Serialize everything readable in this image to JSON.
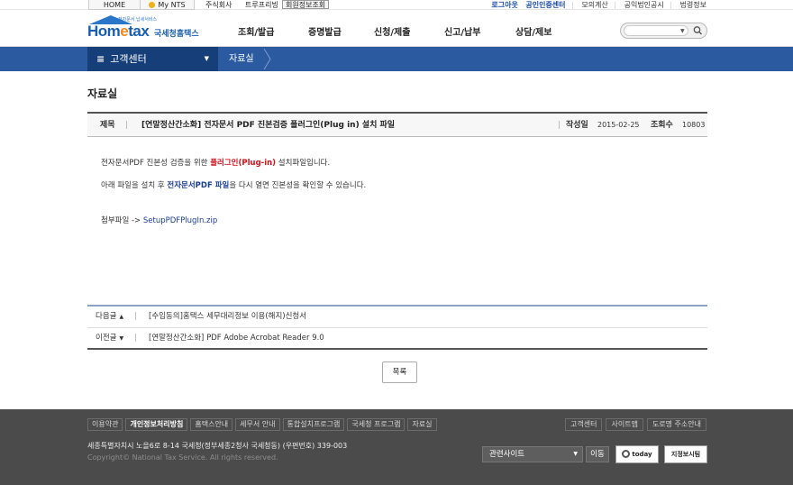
{
  "util": {
    "home": "HOME",
    "mynts": "My NTS",
    "link_a": "주식회사",
    "link_b": "트루프리빙",
    "link_c": "회원정보조회",
    "right": [
      "로그아웃",
      "공인인증센터",
      "모의계산",
      "공익법인공시",
      "법령정보"
    ]
  },
  "header": {
    "logo_small": "전자문서 납세서비스",
    "logo_word_a": "Hom",
    "logo_word_e": "e",
    "logo_word_b": "tax",
    "logo_kr": "국세청홈택스",
    "gnb": [
      "조회/발급",
      "증명발급",
      "신청/제출",
      "신고/납부",
      "상담/제보"
    ],
    "search_placeholder": ""
  },
  "bluebar": {
    "menu_label": "고객센터",
    "crumb": "자료실"
  },
  "content": {
    "page_title": "자료실",
    "subject_label": "제목",
    "subject": "[연말정산간소화] 전자문서 PDF 진본검증 플러그인(Plug in) 설치 파일",
    "written_label": "작성일",
    "written_date": "2015-02-25",
    "views_label": "조회수",
    "views": "10803",
    "line1_a": "전자문서PDF 진본성 검증을 위한 ",
    "line1_red": "플러그인(Plug-in)",
    "line1_b": " 설치파일입니다.",
    "line2_a": "아래 파일을 설치 후 ",
    "line2_navy": "전자문서PDF 파일",
    "line2_b": "을 다시 열면 진본성을 확인할 수 있습니다.",
    "attach_label": "첨부파일 ->",
    "attach_file": "SetupPDFPlugIn.zip",
    "next_label": "다음글",
    "next_title": "[수임동의]홈택스 세무대리정보 이용(해지)신청서",
    "prev_label": "이전글",
    "prev_title": "[연말정산간소화] PDF Adobe Acrobat Reader 9.0",
    "list_button": "목록"
  },
  "footer": {
    "links": [
      "이용약관",
      "개인정보처리방침",
      "홈택스안내",
      "세무서 안내",
      "통합설치프로그램",
      "국세청 프로그램",
      "자료실"
    ],
    "right_links": [
      "고객센터",
      "사이트맵",
      "도로명 주소안내"
    ],
    "address": "세종특별자치시 노을6로 8-14 국세청(정부세종2청사 국세청동) (우편번호) 339-003",
    "copyright": "Copyright© National Tax Service. All rights reserved.",
    "select_label": "관련사이트",
    "go_label": "이동",
    "badge_a": "today",
    "badge_b": "지정보시팀"
  }
}
